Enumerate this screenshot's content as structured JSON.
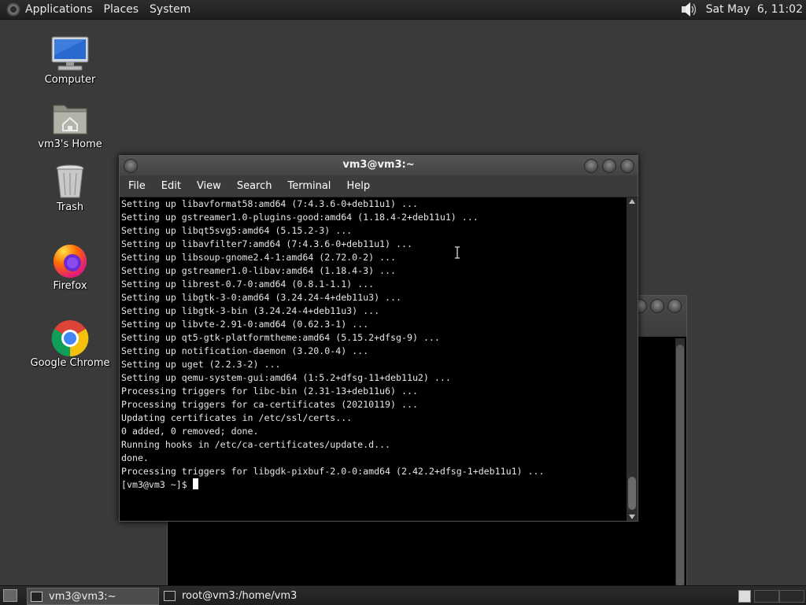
{
  "top_panel": {
    "menus": [
      "Applications",
      "Places",
      "System"
    ],
    "clock": "Sat May  6, 11:02",
    "icons": [
      "gnome-foot-icon",
      "speaker-icon"
    ]
  },
  "desktop_icons": [
    {
      "label": "Computer",
      "icon": "computer-icon"
    },
    {
      "label": "vm3's Home",
      "icon": "home-folder-icon"
    },
    {
      "label": "Trash",
      "icon": "trash-icon"
    },
    {
      "label": "Firefox",
      "icon": "firefox-icon"
    },
    {
      "label": "Google Chrome",
      "icon": "chrome-icon"
    }
  ],
  "terminal": {
    "title": "vm3@vm3:~",
    "menu": [
      "File",
      "Edit",
      "View",
      "Search",
      "Terminal",
      "Help"
    ],
    "lines": [
      "Setting up libavformat58:amd64 (7:4.3.6-0+deb11u1) ...",
      "Setting up gstreamer1.0-plugins-good:amd64 (1.18.4-2+deb11u1) ...",
      "Setting up libqt5svg5:amd64 (5.15.2-3) ...",
      "Setting up libavfilter7:amd64 (7:4.3.6-0+deb11u1) ...",
      "Setting up libsoup-gnome2.4-1:amd64 (2.72.0-2) ...",
      "Setting up gstreamer1.0-libav:amd64 (1.18.4-3) ...",
      "Setting up librest-0.7-0:amd64 (0.8.1-1.1) ...",
      "Setting up libgtk-3-0:amd64 (3.24.24-4+deb11u3) ...",
      "Setting up libgtk-3-bin (3.24.24-4+deb11u3) ...",
      "Setting up libvte-2.91-0:amd64 (0.62.3-1) ...",
      "Setting up qt5-gtk-platformtheme:amd64 (5.15.2+dfsg-9) ...",
      "Setting up notification-daemon (3.20.0-4) ...",
      "Setting up uget (2.2.3-2) ...",
      "Setting up qemu-system-gui:amd64 (1:5.2+dfsg-11+deb11u2) ...",
      "Processing triggers for libc-bin (2.31-13+deb11u6) ...",
      "Processing triggers for ca-certificates (20210119) ...",
      "Updating certificates in /etc/ssl/certs...",
      "0 added, 0 removed; done.",
      "Running hooks in /etc/ca-certificates/update.d...",
      "done.",
      "Processing triggers for libgdk-pixbuf-2.0-0:amd64 (2.42.2+dfsg-1+deb11u1) ...",
      "[vm3@vm3 ~]$ "
    ]
  },
  "taskbar": {
    "tasks": [
      {
        "label": "vm3@vm3:~",
        "active": true
      },
      {
        "label": "root@vm3:/home/vm3",
        "active": false
      }
    ]
  }
}
